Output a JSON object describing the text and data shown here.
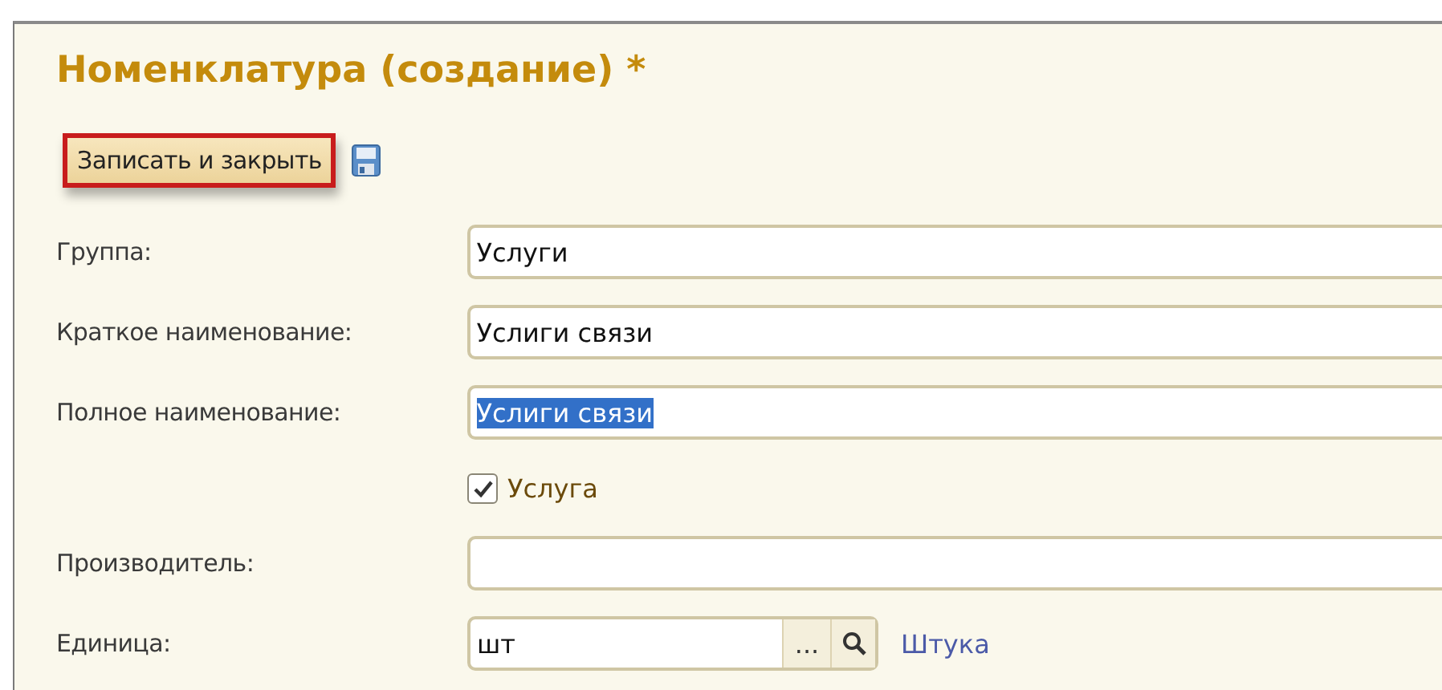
{
  "window": {
    "title": "Номенклатура (создание) *"
  },
  "toolbar": {
    "save_close": "Записать и закрыть",
    "focused": true
  },
  "fields": [
    {
      "kind": "text",
      "label": "Группа:",
      "value": "Услуги"
    },
    {
      "kind": "text",
      "label": "Краткое наименование:",
      "value": "Услиги связи"
    },
    {
      "kind": "text",
      "label": "Полное наименование:",
      "value": "Услиги связи",
      "selected_text": true
    },
    {
      "kind": "checkbox",
      "label": "Услуга",
      "checked": true
    },
    {
      "kind": "text",
      "label": "Производитель:"
    },
    {
      "kind": "lookup",
      "label": "Единица:",
      "value": "шт",
      "choose": "...",
      "link": "Штука"
    }
  ]
}
